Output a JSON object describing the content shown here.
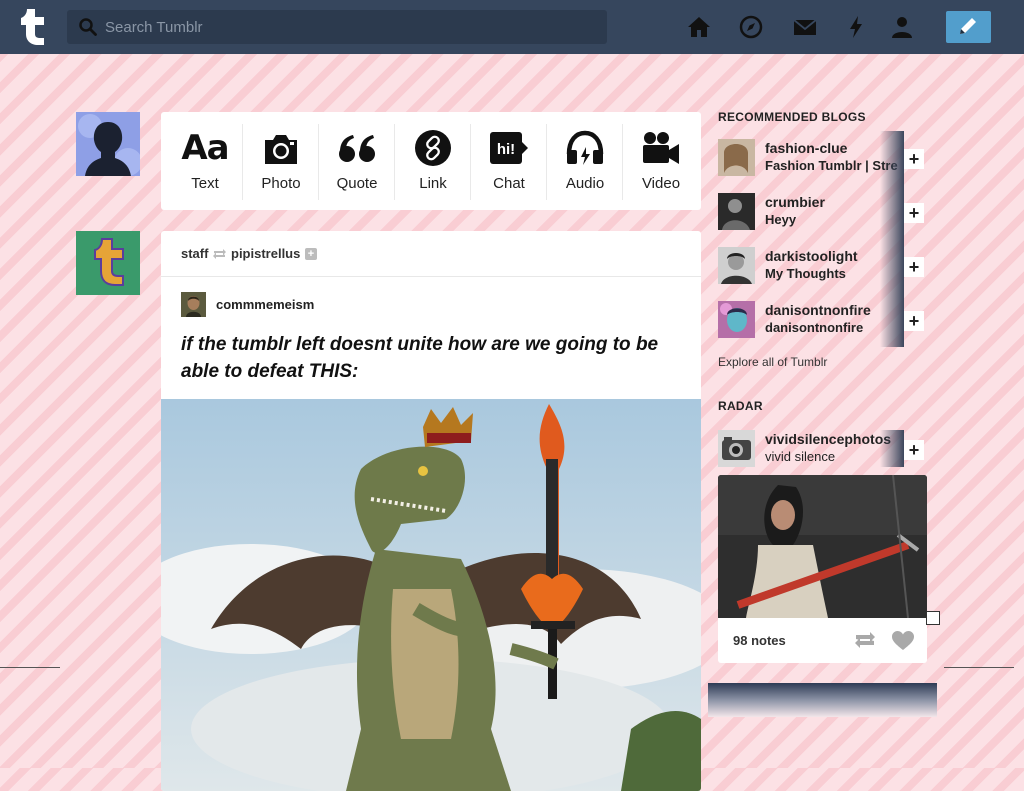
{
  "search": {
    "placeholder": "Search Tumblr"
  },
  "nav": [
    "home-icon",
    "explore-icon",
    "messages-icon",
    "activity-icon",
    "account-icon"
  ],
  "post_types": [
    {
      "label": "Text",
      "icon": "text-icon"
    },
    {
      "label": "Photo",
      "icon": "camera-icon"
    },
    {
      "label": "Quote",
      "icon": "quote-icon"
    },
    {
      "label": "Link",
      "icon": "link-icon"
    },
    {
      "label": "Chat",
      "icon": "chat-icon"
    },
    {
      "label": "Audio",
      "icon": "headphones-icon"
    },
    {
      "label": "Video",
      "icon": "video-camera-icon"
    }
  ],
  "chat_bubble_text": "hi!",
  "text_icon_glyph": "Aa",
  "post": {
    "poster": "staff",
    "reblogged_from": "pipistrellus",
    "original_author": "commmemeism",
    "title": "if the tumblr left doesnt unite how are we going to be able to defeat THIS:"
  },
  "sidebar": {
    "recommended_title": "RECOMMENDED BLOGS",
    "blogs": [
      {
        "name": "fashion-clue",
        "title": "Fashion Tumblr | Stre"
      },
      {
        "name": "crumbier",
        "title": "Heyy"
      },
      {
        "name": "darkistoolight",
        "title": "My Thoughts"
      },
      {
        "name": "danisontnonfire",
        "title": "danisontnonfire"
      }
    ],
    "explore_link": "Explore all of Tumblr",
    "radar_title": "RADAR",
    "radar": {
      "name": "vividsilencephotos",
      "title": "vivid silence",
      "notes": "98 notes"
    }
  },
  "colors": {
    "topbar": "#36465d",
    "compose": "#529ecc",
    "background": "#fde3e7"
  }
}
